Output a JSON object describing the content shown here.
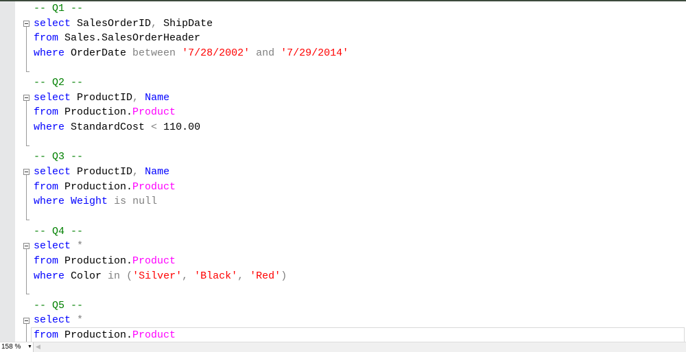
{
  "editor": {
    "lines": [
      [
        [
          "c",
          "-- Q1 --"
        ]
      ],
      [
        [
          "k",
          "select"
        ],
        [
          "i",
          " SalesOrderID"
        ],
        [
          "o",
          ","
        ],
        [
          "i",
          " ShipDate"
        ]
      ],
      [
        [
          "k",
          "from"
        ],
        [
          "i",
          " Sales.SalesOrderHeader"
        ]
      ],
      [
        [
          "k",
          "where"
        ],
        [
          "i",
          " OrderDate "
        ],
        [
          "o",
          "between"
        ],
        [
          "i",
          " "
        ],
        [
          "s",
          "'7/28/2002'"
        ],
        [
          "i",
          " "
        ],
        [
          "o",
          "and"
        ],
        [
          "i",
          " "
        ],
        [
          "s",
          "'7/29/2014'"
        ]
      ],
      [],
      [
        [
          "c",
          "-- Q2 --"
        ]
      ],
      [
        [
          "k",
          "select"
        ],
        [
          "i",
          " ProductID"
        ],
        [
          "o",
          ","
        ],
        [
          "i",
          " "
        ],
        [
          "k",
          "Name"
        ]
      ],
      [
        [
          "k",
          "from"
        ],
        [
          "i",
          " Production."
        ],
        [
          "m",
          "Product"
        ]
      ],
      [
        [
          "k",
          "where"
        ],
        [
          "i",
          " StandardCost "
        ],
        [
          "o",
          "<"
        ],
        [
          "i",
          " 110.00"
        ]
      ],
      [],
      [
        [
          "c",
          "-- Q3 --"
        ]
      ],
      [
        [
          "k",
          "select"
        ],
        [
          "i",
          " ProductID"
        ],
        [
          "o",
          ","
        ],
        [
          "i",
          " "
        ],
        [
          "k",
          "Name"
        ]
      ],
      [
        [
          "k",
          "from"
        ],
        [
          "i",
          " Production."
        ],
        [
          "m",
          "Product"
        ]
      ],
      [
        [
          "k",
          "where"
        ],
        [
          "i",
          " "
        ],
        [
          "k",
          "Weight"
        ],
        [
          "i",
          " "
        ],
        [
          "o",
          "is null"
        ]
      ],
      [],
      [
        [
          "c",
          "-- Q4 --"
        ]
      ],
      [
        [
          "k",
          "select"
        ],
        [
          "i",
          " "
        ],
        [
          "o",
          "*"
        ]
      ],
      [
        [
          "k",
          "from"
        ],
        [
          "i",
          " Production."
        ],
        [
          "m",
          "Product"
        ]
      ],
      [
        [
          "k",
          "where"
        ],
        [
          "i",
          " Color "
        ],
        [
          "o",
          "in"
        ],
        [
          "i",
          " "
        ],
        [
          "o",
          "("
        ],
        [
          "s",
          "'Silver'"
        ],
        [
          "o",
          ","
        ],
        [
          "i",
          " "
        ],
        [
          "s",
          "'Black'"
        ],
        [
          "o",
          ","
        ],
        [
          "i",
          " "
        ],
        [
          "s",
          "'Red'"
        ],
        [
          "o",
          ")"
        ]
      ],
      [],
      [
        [
          "c",
          "-- Q5 --"
        ]
      ],
      [
        [
          "k",
          "select"
        ],
        [
          "i",
          " "
        ],
        [
          "o",
          "*"
        ]
      ],
      [
        [
          "k",
          "from"
        ],
        [
          "i",
          " Production."
        ],
        [
          "m",
          "Product"
        ]
      ]
    ],
    "current_line": 22,
    "fold_starts": [
      1,
      6,
      11,
      16,
      21
    ]
  },
  "status": {
    "zoom_level": "158 %"
  },
  "colors": {
    "keyword": "#0000ff",
    "string": "#ff0000",
    "comment": "#008000",
    "operator": "#808080",
    "object": "#ff00ff"
  }
}
